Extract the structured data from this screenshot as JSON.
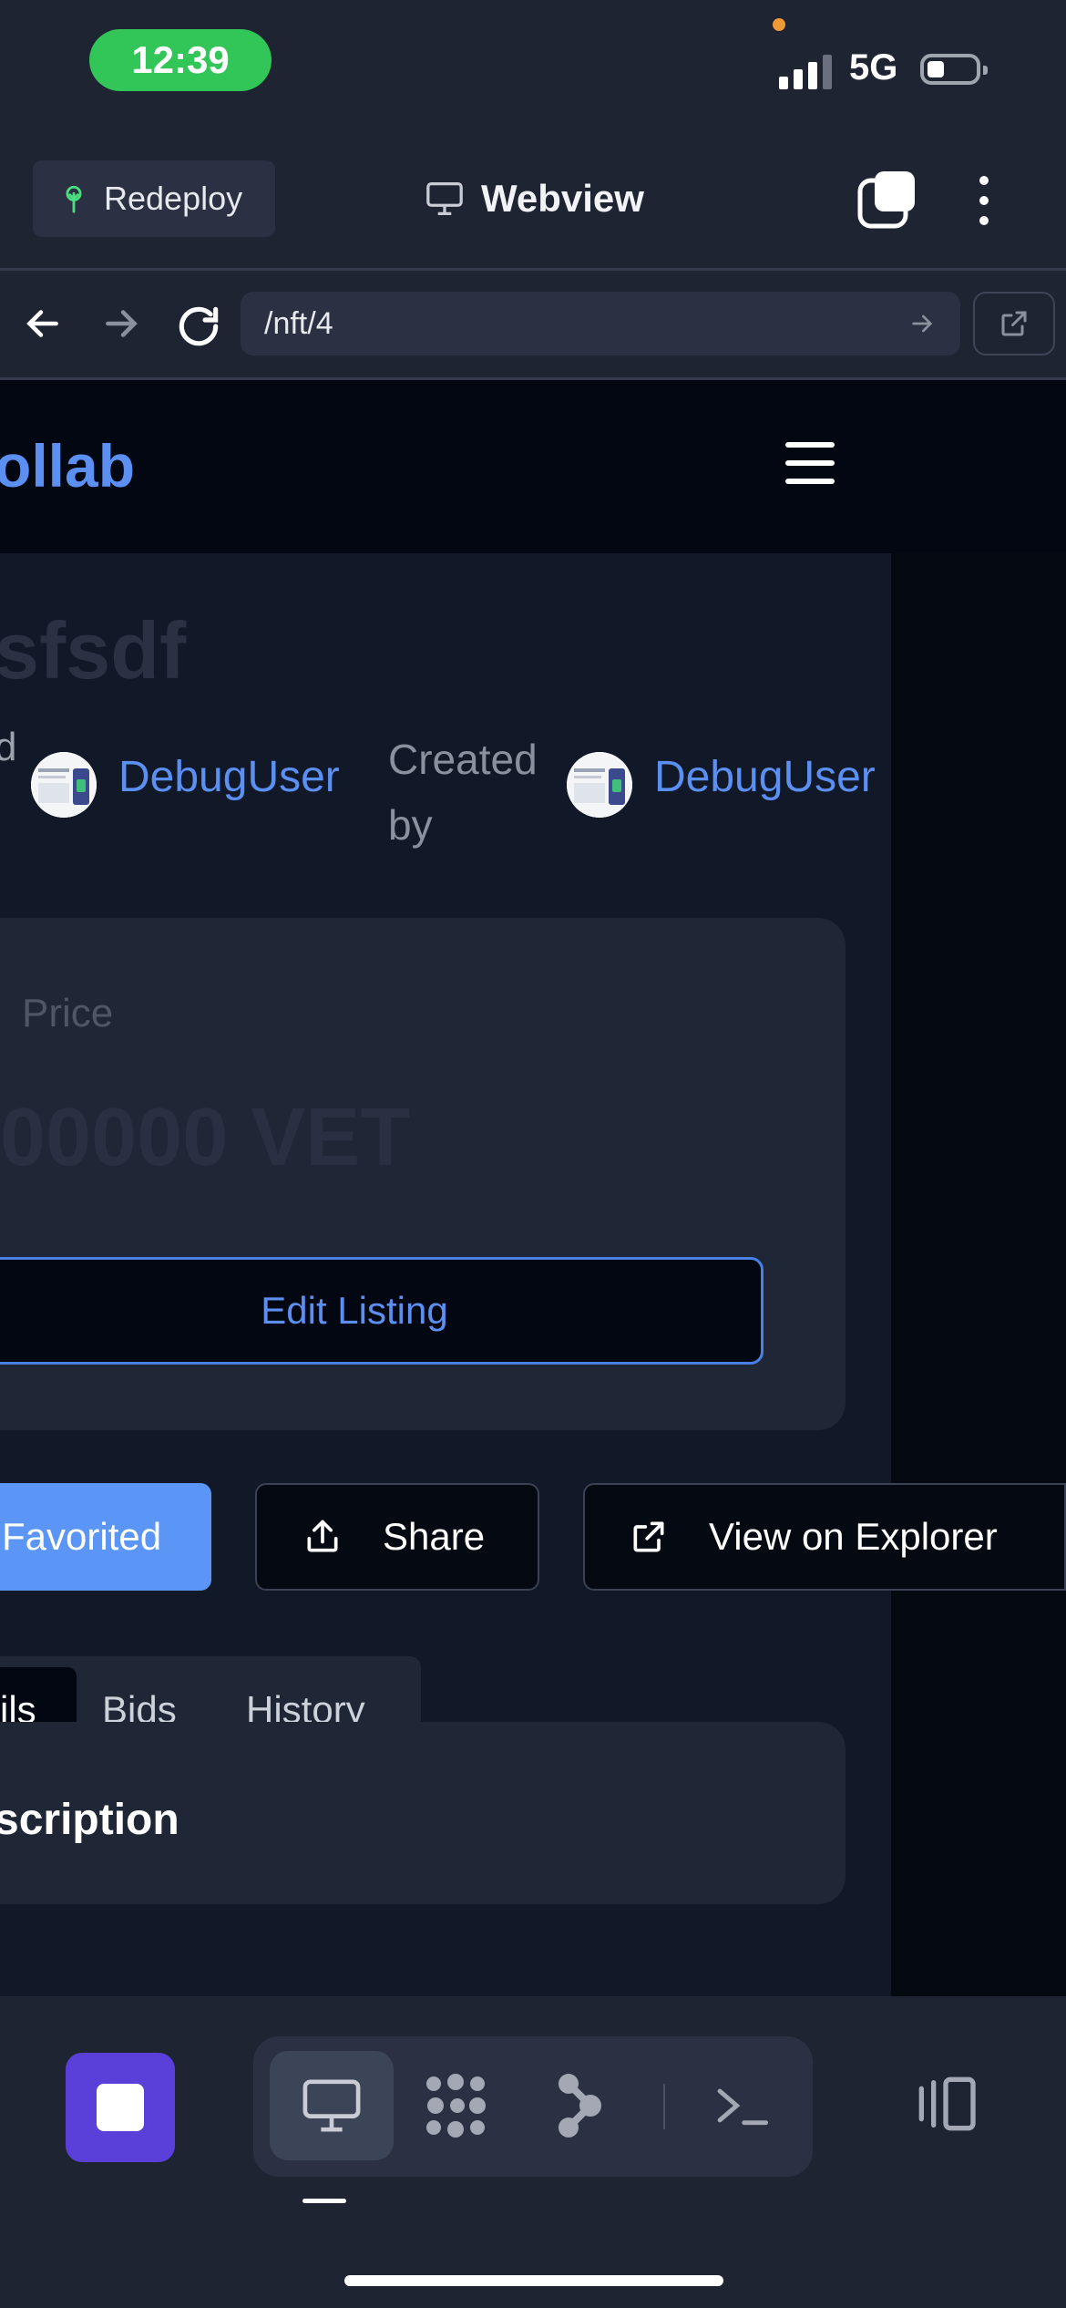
{
  "status_bar": {
    "time": "12:39",
    "network": "5G",
    "time_color": "#32c659"
  },
  "toolbar": {
    "redeploy_label": "Redeploy",
    "view_title": "Webview"
  },
  "browser": {
    "url": "/nft/4"
  },
  "site": {
    "brand": "ollab",
    "brand_color": "#5b8ff2",
    "nft_title": "sfsdf",
    "owner_label_fragment": "d",
    "owner_name": "DebugUser",
    "created_by_label": "Created by",
    "creator_name": "DebugUser",
    "price_label": "Price",
    "price_value": "00000 VET",
    "edit_listing_label": "Edit Listing",
    "favorited_label": "Favorited",
    "share_label": "Share",
    "explorer_label": "View on Explorer",
    "tabs": [
      {
        "label": "ils",
        "active": true
      },
      {
        "label": "Bids",
        "active": false
      },
      {
        "label": "History",
        "active": false
      }
    ],
    "description_heading": "scription"
  },
  "bottom_bar": {
    "stop_color": "#5a3fd9",
    "modes": [
      "desktop-icon",
      "grid-dots-icon",
      "node-graph-icon",
      "terminal-icon"
    ],
    "active_mode": "desktop-icon"
  }
}
